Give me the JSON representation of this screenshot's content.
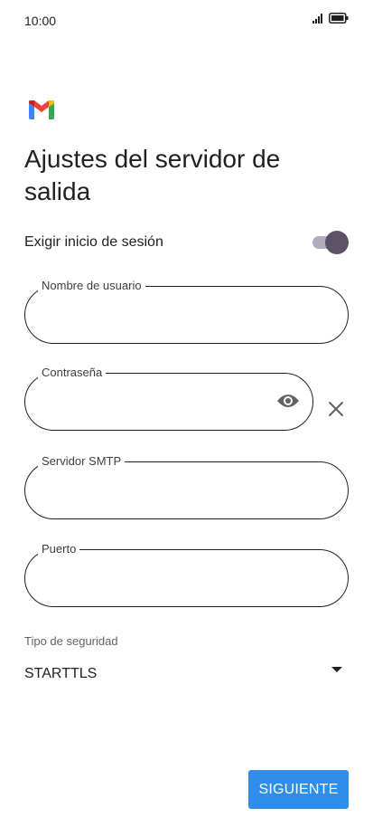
{
  "status_bar": {
    "time": "10:00",
    "signal_icon": "signal-icon",
    "battery_icon": "battery-icon"
  },
  "logo": "gmail-logo",
  "title": "Ajustes del servidor de salida",
  "require_login": {
    "label": "Exigir inicio de sesión",
    "enabled": true
  },
  "fields": {
    "username": {
      "label": "Nombre de usuario",
      "value": ""
    },
    "password": {
      "label": "Contraseña",
      "value": "",
      "toggle_icon": "eye-icon",
      "clear_icon": "close-icon"
    },
    "smtp_server": {
      "label": "Servidor SMTP",
      "value": ""
    },
    "port": {
      "label": "Puerto",
      "value": ""
    }
  },
  "security": {
    "label": "Tipo de seguridad",
    "value": "STARTTLS",
    "icon": "dropdown-arrow-icon"
  },
  "next_button": {
    "label": "SIGUIENTE"
  },
  "colors": {
    "accent": "#2f8eea",
    "toggle_thumb": "#5b5269",
    "toggle_track": "#b1acbd",
    "text": "#202124"
  }
}
